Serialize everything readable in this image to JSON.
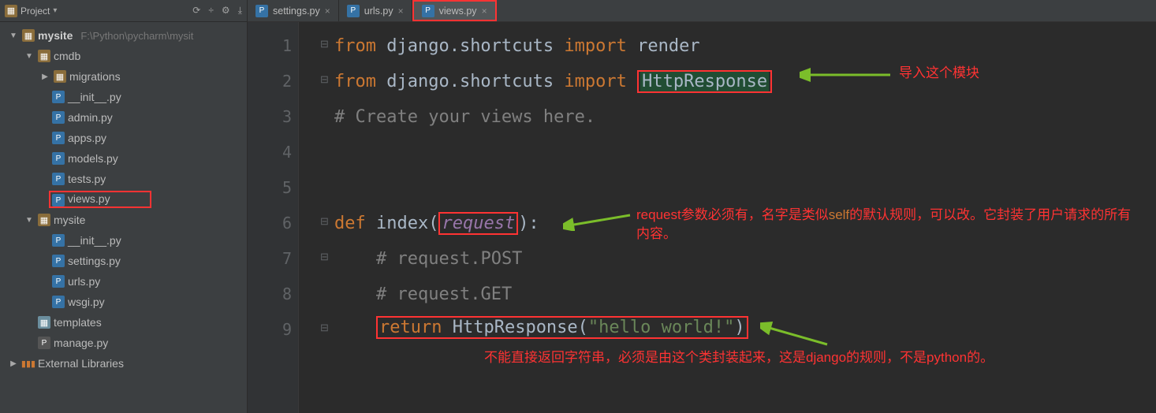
{
  "sidebar": {
    "title": "Project",
    "toolbar_icons": [
      "⟳",
      "÷",
      "⚙",
      "⤓"
    ],
    "project": {
      "name": "mysite",
      "path": "F:\\Python\\pycharm\\mysit"
    },
    "cmdb": {
      "label": "cmdb",
      "migrations": "migrations",
      "files": [
        "__init__.py",
        "admin.py",
        "apps.py",
        "models.py",
        "tests.py",
        "views.py"
      ]
    },
    "mysite": {
      "label": "mysite",
      "files": [
        "__init__.py",
        "settings.py",
        "urls.py",
        "wsgi.py"
      ]
    },
    "templates": "templates",
    "manage": "manage.py",
    "external": "External Libraries"
  },
  "tabs": [
    "settings.py",
    "urls.py",
    "views.py"
  ],
  "active_tab_index": 2,
  "line_numbers": [
    "1",
    "2",
    "3",
    "4",
    "5",
    "6",
    "7",
    "8",
    "9"
  ],
  "code": {
    "l1": {
      "from": "from",
      "mod": " django.shortcuts ",
      "imp": "import",
      "rest": " render"
    },
    "l2": {
      "from": "from",
      "mod": " django.shortcuts ",
      "imp": "import",
      "name": "HttpResponse"
    },
    "l3": "# Create your views here.",
    "l6": {
      "def": "def",
      "name": " index(",
      "arg": "request",
      "tail": "):"
    },
    "l7": "# request.POST",
    "l8": "# request.GET",
    "l9": {
      "ret": "return",
      "call": " HttpResponse(",
      "str": "\"hello world!\"",
      "end": ")"
    }
  },
  "annotations": {
    "import_module": "导入这个模块",
    "request_note_a": "request参数必须有，名字是类似",
    "request_note_self": "self",
    "request_note_b": "的默认规则，可以改。它封装了用户请求的所有内容。",
    "return_note": "不能直接返回字符串，必须是由这个类封装起来，这是django的规则，不是python的。"
  }
}
